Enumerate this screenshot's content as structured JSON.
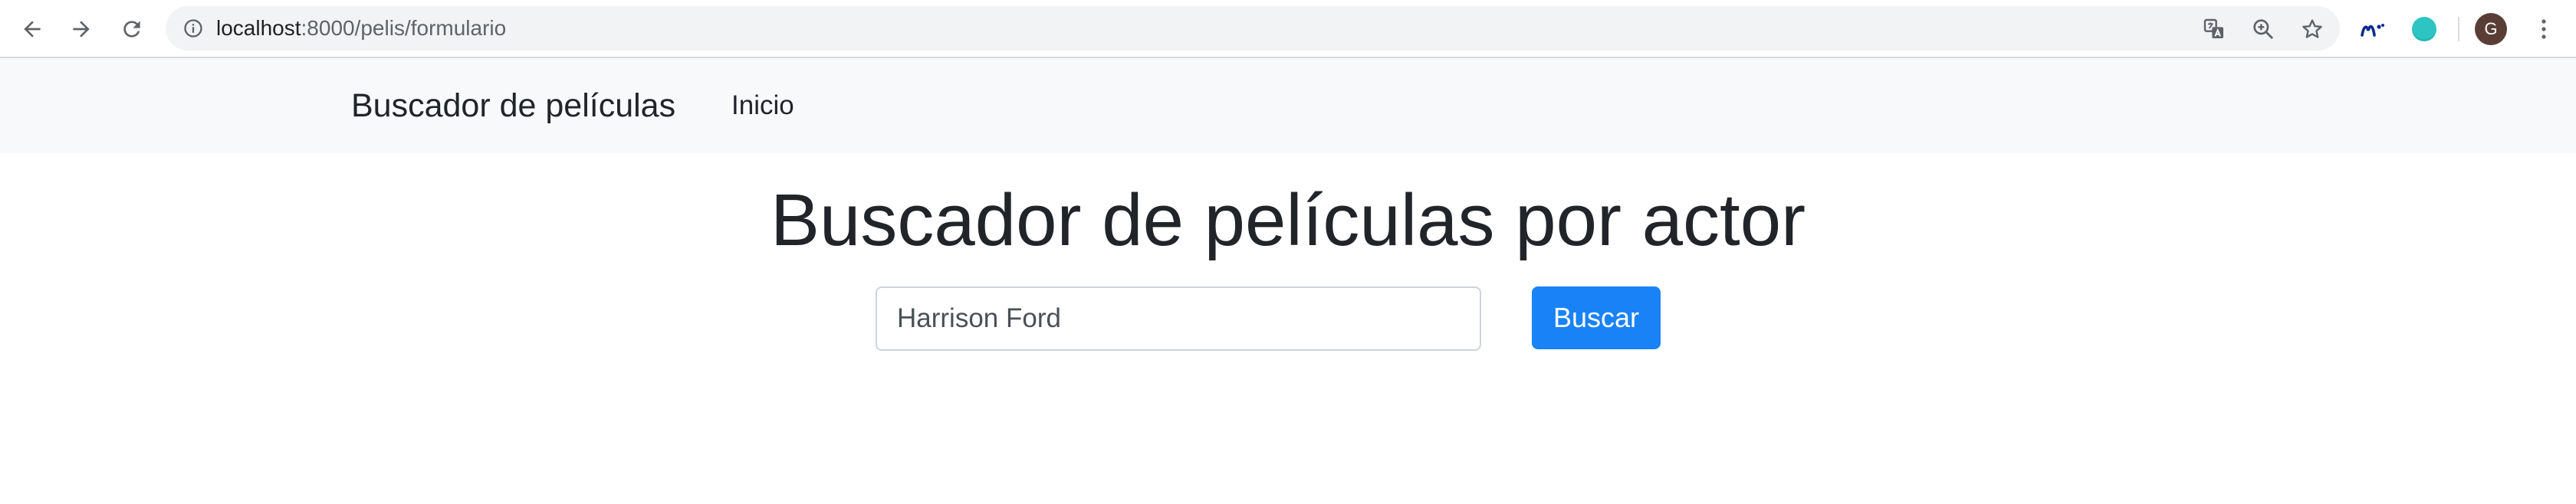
{
  "browser": {
    "url_host": "localhost",
    "url_path": ":8000/pelis/formulario",
    "profile_initial": "G",
    "icons": {
      "back": "arrow-left-icon",
      "forward": "arrow-right-icon",
      "reload": "reload-icon",
      "site_info": "info-icon",
      "translate": "translate-icon",
      "zoom": "zoom-in-icon",
      "bookmark": "star-icon",
      "extension_1": "movistar-extension-icon",
      "extension_2": "teal-circle-extension-icon",
      "menu": "kebab-menu-icon"
    },
    "colors": {
      "omnibox_bg": "#f1f3f4",
      "avatar_bg": "#5a3e36",
      "extension_teal": "#2ec4c4",
      "extension_blue": "#0b2d8e"
    }
  },
  "navbar": {
    "brand": "Buscador de películas",
    "links": [
      "Inicio"
    ]
  },
  "main": {
    "title": "Buscador de películas por actor",
    "search": {
      "value": "Harrison Ford",
      "button_label": "Buscar"
    }
  },
  "colors": {
    "navbar_bg": "#f8f9fa",
    "primary_button": "#1a82f7",
    "text": "#212529"
  }
}
